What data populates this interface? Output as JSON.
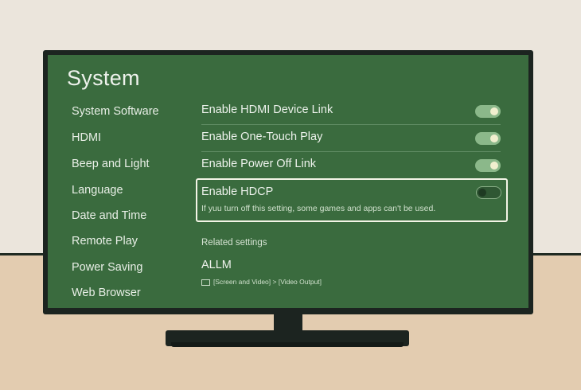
{
  "screen": {
    "title": "System"
  },
  "sidebar": {
    "items": [
      {
        "label": "System Software"
      },
      {
        "label": "HDMI"
      },
      {
        "label": "Beep and Light"
      },
      {
        "label": "Language"
      },
      {
        "label": "Date and Time"
      },
      {
        "label": "Remote Play"
      },
      {
        "label": "Power Saving"
      },
      {
        "label": "Web Browser"
      }
    ]
  },
  "settings": {
    "items": [
      {
        "label": "Enable HDMI Device Link",
        "enabled": true
      },
      {
        "label": "Enable One-Touch Play",
        "enabled": true
      },
      {
        "label": "Enable Power Off Link",
        "enabled": true
      }
    ],
    "hdcp": {
      "label": "Enable HDCP",
      "description": "If yuu turn off this setting, some games and apps can't be used.",
      "enabled": false
    }
  },
  "related": {
    "heading": "Related settings",
    "item_label": "ALLM",
    "path": "[Screen and Video] > [Video Output]",
    "path_icon": "tv-icon"
  },
  "colors": {
    "screen_bg": "#3a6b3e",
    "toggle_on": "#8bb88a",
    "focus_border": "#f3f4e6"
  }
}
